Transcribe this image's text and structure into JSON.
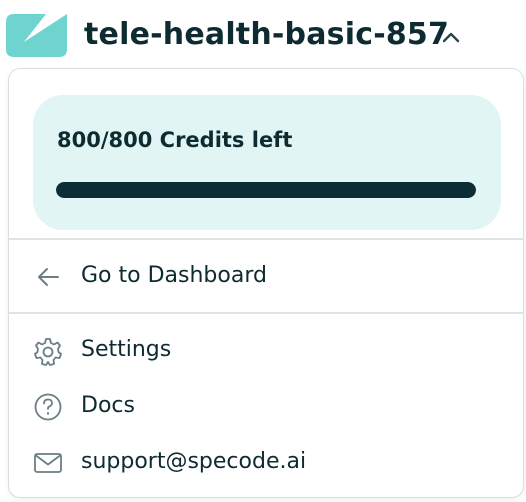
{
  "header": {
    "project_name": "tele-health-basic-857",
    "logo_icon": "brand-logo-icon",
    "toggle_icon": "chevron-up-icon"
  },
  "credits": {
    "label": "800/800 Credits left",
    "used": 800,
    "total": 800,
    "remaining_fraction": 1.0
  },
  "menu": {
    "dashboard": {
      "label": "Go to Dashboard",
      "icon": "arrow-left-icon"
    },
    "settings": {
      "label": "Settings",
      "icon": "gear-icon"
    },
    "docs": {
      "label": "Docs",
      "icon": "help-circle-icon"
    },
    "support": {
      "label": "support@specode.ai",
      "icon": "mail-icon"
    }
  },
  "colors": {
    "brand_teal": "#6fd3cf",
    "card_background": "#e0f5f4",
    "progress_fill": "#0c2d33",
    "text_primary": "#0d2b30",
    "icon_gray": "#6b7f82"
  }
}
